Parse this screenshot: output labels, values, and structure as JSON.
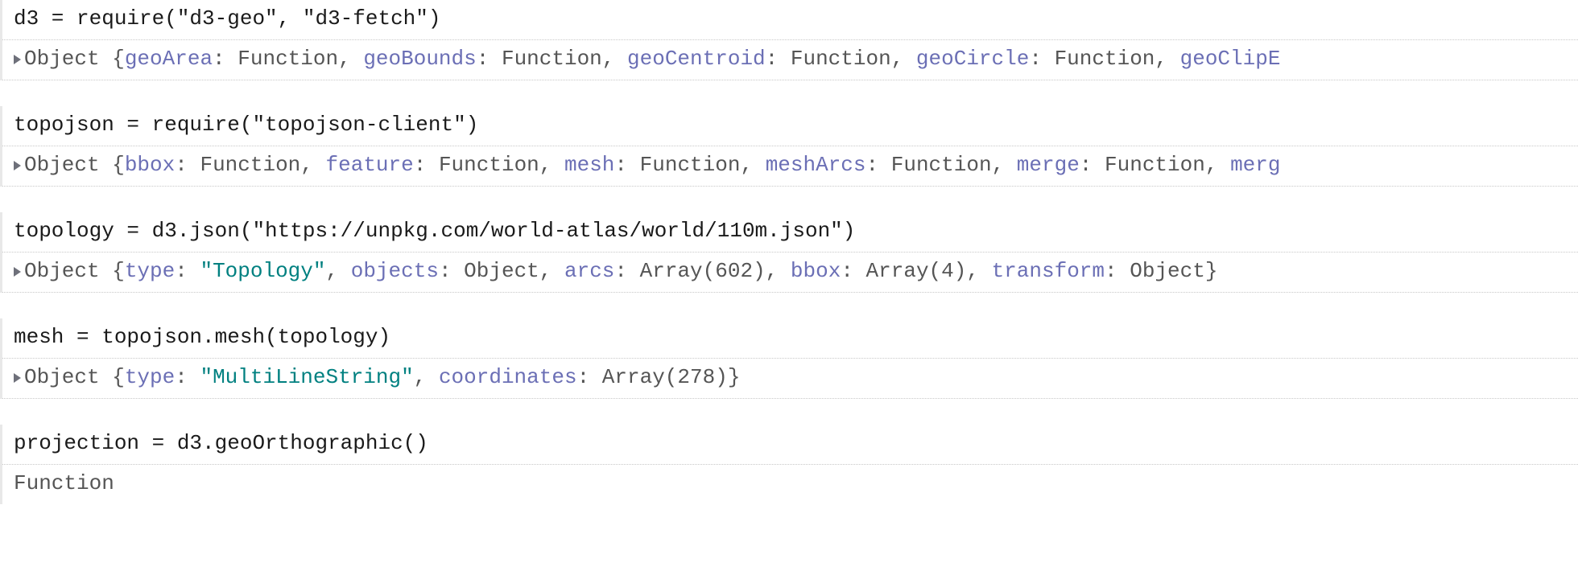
{
  "cells": [
    {
      "code": "d3 = require(\"d3-geo\", \"d3-fetch\")",
      "output": {
        "expandable": true,
        "prefix": "Object {",
        "entries": [
          {
            "key": "geoArea",
            "val": "Function"
          },
          {
            "key": "geoBounds",
            "val": "Function"
          },
          {
            "key": "geoCentroid",
            "val": "Function"
          },
          {
            "key": "geoCircle",
            "val": "Function"
          },
          {
            "key": "geoClipE",
            "val": ""
          }
        ]
      }
    },
    {
      "code": "topojson = require(\"topojson-client\")",
      "output": {
        "expandable": true,
        "prefix": "Object {",
        "entries": [
          {
            "key": "bbox",
            "val": "Function"
          },
          {
            "key": "feature",
            "val": "Function"
          },
          {
            "key": "mesh",
            "val": "Function"
          },
          {
            "key": "meshArcs",
            "val": "Function"
          },
          {
            "key": "merge",
            "val": "Function"
          },
          {
            "key": "merg",
            "val": ""
          }
        ]
      }
    },
    {
      "code": "topology = d3.json(\"https://unpkg.com/world-atlas/world/110m.json\")",
      "output": {
        "expandable": true,
        "prefix": "Object {",
        "entries": [
          {
            "key": "type",
            "val": "\"Topology\"",
            "isString": true
          },
          {
            "key": "objects",
            "val": "Object"
          },
          {
            "key": "arcs",
            "val": "Array(602)"
          },
          {
            "key": "bbox",
            "val": "Array(4)"
          },
          {
            "key": "transform",
            "val": "Object"
          }
        ],
        "suffix": "}"
      }
    },
    {
      "code": "mesh = topojson.mesh(topology)",
      "output": {
        "expandable": true,
        "prefix": "Object {",
        "entries": [
          {
            "key": "type",
            "val": "\"MultiLineString\"",
            "isString": true
          },
          {
            "key": "coordinates",
            "val": "Array(278)"
          }
        ],
        "suffix": "}"
      }
    },
    {
      "code": "projection = d3.geoOrthographic()",
      "output": {
        "plain": "Function"
      }
    }
  ]
}
